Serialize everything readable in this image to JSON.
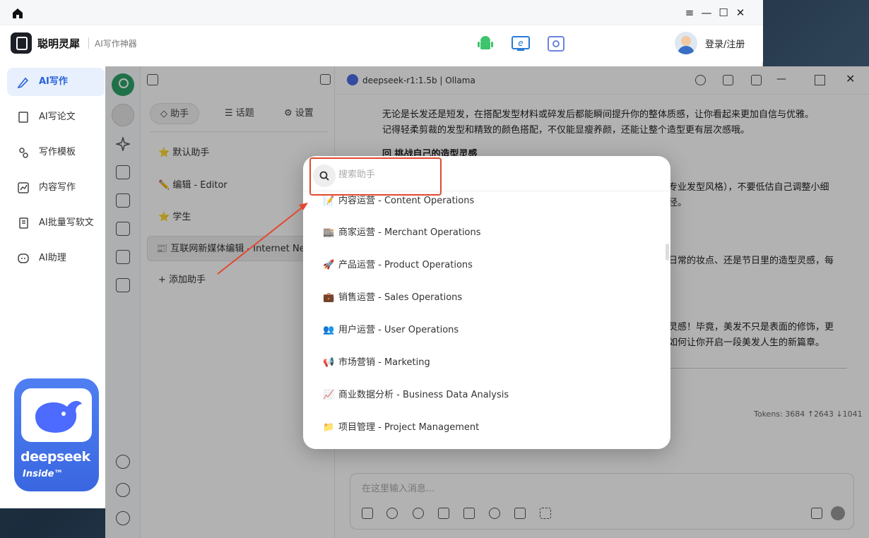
{
  "outer": {
    "app_name": "聪明灵犀",
    "app_tagline": "AI写作神器",
    "login": "登录/注册",
    "window_controls": [
      "≡",
      "—",
      "☐",
      "✕"
    ],
    "nav": [
      {
        "label": "AI写作",
        "icon": "pen-sparkle-icon",
        "active": true
      },
      {
        "label": "AI写论文",
        "icon": "paper-icon"
      },
      {
        "label": "写作模板",
        "icon": "template-icon"
      },
      {
        "label": "内容写作",
        "icon": "chart-doc-icon"
      },
      {
        "label": "AI批量写软文",
        "icon": "batch-doc-icon"
      },
      {
        "label": "AI助理",
        "icon": "robot-icon"
      }
    ],
    "promo": {
      "word": "deepseek",
      "inside": "Inside™"
    }
  },
  "inner": {
    "model_label": "deepseek-r1:1.5b | Ollama",
    "tabs": [
      {
        "label": "◇ 助手"
      },
      {
        "label": "☰ 话题"
      },
      {
        "label": "⚙ 设置"
      }
    ],
    "assistants": [
      {
        "label": "⭐ 默认助手"
      },
      {
        "label": "✏️ 编辑 - Editor"
      },
      {
        "label": "⭐ 学生"
      },
      {
        "label": "📰 互联网新媒体编辑 - Internet New Media Editor"
      },
      {
        "label": "+ 添加助手"
      }
    ],
    "chat_lines": [
      "无论是长发还是短发，在搭配发型材料或碎发后都能瞬间提升你的整体质感，让你看起来更加自信与优雅。",
      "记得轻柔剪裁的发型和精致的颜色搭配，不仅能显瘦养颜，还能让整个造型更有层次感哦。",
      "回 挑战自己的造型灵感",
      "专业发型风格），不要低估自己调整小细",
      "径。",
      "日常的妆点、还是节日里的造型灵感，每",
      "灵感！毕竟，美发不只是表面的修饰，更",
      "如何让你开启一段美发人生的新篇章。"
    ],
    "tokens": "Tokens: 3684 ↑2643 ↓1041",
    "input_placeholder": "在这里输入消息..."
  },
  "modal": {
    "search_placeholder": "搜索助手",
    "items": [
      {
        "emoji": "📝",
        "label": "内容运营 - Content Operations"
      },
      {
        "emoji": "🏬",
        "label": "商家运营 - Merchant Operations"
      },
      {
        "emoji": "🚀",
        "label": "产品运营 - Product Operations"
      },
      {
        "emoji": "💼",
        "label": "销售运营 - Sales Operations"
      },
      {
        "emoji": "👥",
        "label": "用户运营 - User Operations"
      },
      {
        "emoji": "📢",
        "label": "市场营销 - Marketing"
      },
      {
        "emoji": "📈",
        "label": "商业数据分析 - Business Data Analysis"
      },
      {
        "emoji": "📁",
        "label": "项目管理 - Project Management"
      }
    ]
  },
  "colors": {
    "accent": "#2962d9",
    "highlight": "#e2492f"
  }
}
